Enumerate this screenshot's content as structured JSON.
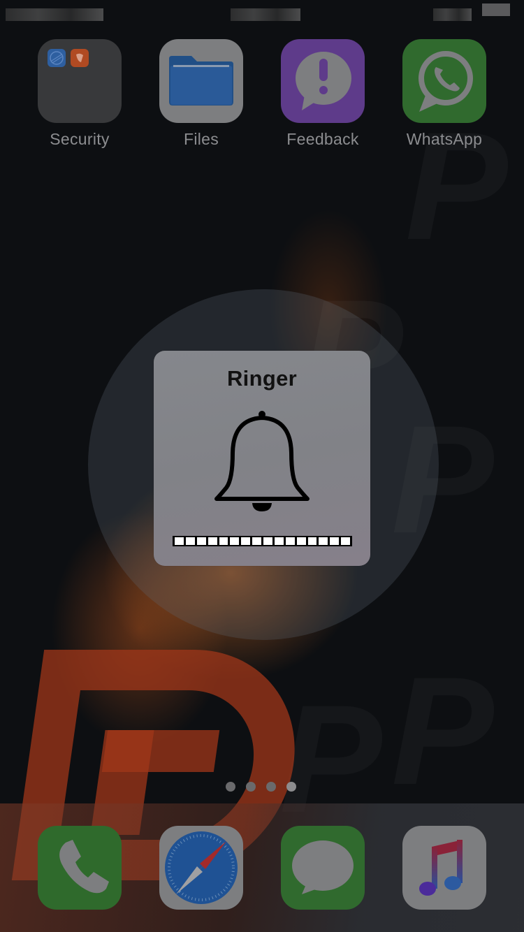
{
  "status_bar": {
    "carrier": "",
    "time": "",
    "battery": ""
  },
  "home_screen": {
    "apps": [
      {
        "label": "Security",
        "icon": "folder-icon",
        "type": "folder",
        "folder_contents": [
          "security-app-icon-globe",
          "security-app-icon-shield"
        ]
      },
      {
        "label": "Files",
        "icon": "folder-icon"
      },
      {
        "label": "Feedback",
        "icon": "feedback-exclamation-bubble-icon"
      },
      {
        "label": "WhatsApp",
        "icon": "whatsapp-phone-bubble-icon"
      }
    ],
    "page_indicator": {
      "pages": 4,
      "current_page": 4
    }
  },
  "dock": {
    "apps": [
      {
        "name": "Phone",
        "icon": "phone-icon"
      },
      {
        "name": "Safari",
        "icon": "compass-icon"
      },
      {
        "name": "Messages",
        "icon": "message-bubble-icon"
      },
      {
        "name": "Music",
        "icon": "music-note-icon"
      }
    ]
  },
  "ringer_hud": {
    "title": "Ringer",
    "icon": "bell-icon",
    "volume": {
      "segments_total": 16,
      "segments_filled": 16,
      "level_fraction": 1.0
    }
  },
  "colors": {
    "hud_background": "#838589",
    "feedback": "#5e3b8a",
    "whatsapp": "#306a2e",
    "wallpaper_accent": "#a0371a"
  }
}
